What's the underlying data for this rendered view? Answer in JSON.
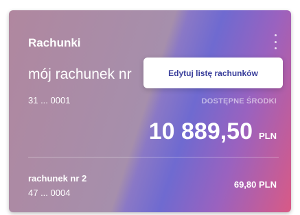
{
  "card": {
    "title": "Rachunki",
    "menu_icon": "kebab-vertical-icon",
    "primary_account": {
      "name": "mój rachunek nr",
      "number": "31 ... 0001",
      "available_label": "DOSTĘPNE ŚRODKI",
      "balance": "10 889,50",
      "currency": "PLN"
    },
    "secondary_account": {
      "name": "rachunek nr 2",
      "number": "47 ... 0004",
      "balance": "69,80 PLN"
    }
  },
  "popup": {
    "edit_list_label": "Edytuj listę rachunków"
  },
  "colors": {
    "gradient_left": "#b0879f",
    "gradient_mid": "#6f6ad0",
    "gradient_right": "#d85a86",
    "popup_text": "#3a3f9c"
  }
}
